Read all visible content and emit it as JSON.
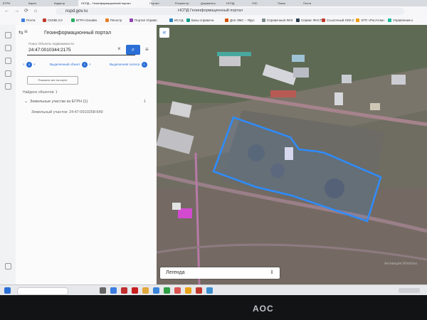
{
  "browser": {
    "tabs": [
      "ЕГРН",
      "Карта",
      "Кадастр",
      "Портал",
      "Росреестр",
      "Документы",
      "НСПД",
      "ГИС",
      "Поиск",
      "Почта"
    ],
    "active_tab": "НСПД – Геоинформационный портал",
    "url": "nspd.gov.ru",
    "page_title": "НСПД Геоинформационный портал"
  },
  "bookmarks": [
    "Почта",
    "СМЭВ 3.0",
    "ЕГРН Онлайн",
    "Регистр",
    "Портал Управл.",
    "ИСАД",
    "Базы справочн.",
    "Для ЭМС – Ярус",
    "Справочный ЛИЗ",
    "Сервис ФНСГ",
    "Ссылочный ЛИЗ 2",
    "ЭТП «РосАтом»",
    "Управление к"
  ],
  "portal": {
    "title": "Геоинформационный портал",
    "search_label": "Поиск Объекты недвижимости",
    "search_value": "24:47:0010344:2175",
    "chips": [
      {
        "count": "4",
        "label": ""
      },
      {
        "count": "1",
        "label": "Выделенный объект"
      },
      {
        "count": "1",
        "label": "Выделенная полоса"
      }
    ],
    "show_button": "Показать все на карте",
    "found_text": "Найдено объектов: 1",
    "group_label": "Земельные участки из ЕГРН (1)",
    "result_item": "Земельный участок: 24:47:0010258:649"
  },
  "map": {
    "legend_label": "Легенда",
    "watermark": "Активация Windows",
    "highlight_color": "#2e8cff"
  },
  "monitor": {
    "brand": "AOC"
  }
}
